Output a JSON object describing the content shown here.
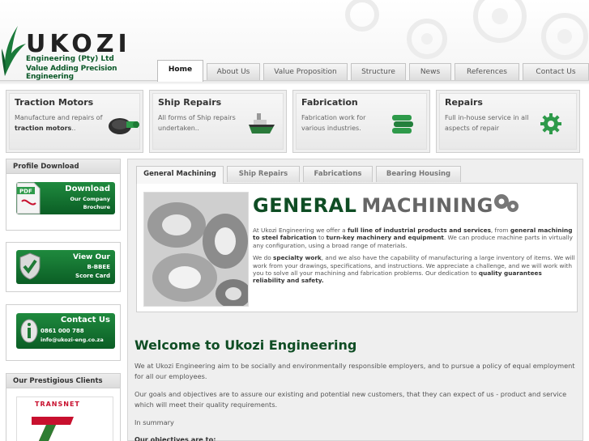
{
  "brand": {
    "name": "UKOZI",
    "sub1": "Engineering (Pty) Ltd",
    "sub2": "Value Adding Precision Engineering"
  },
  "nav": {
    "tabs": [
      {
        "label": "Home",
        "active": true
      },
      {
        "label": "About Us"
      },
      {
        "label": "Value Proposition"
      },
      {
        "label": "Structure"
      },
      {
        "label": "News"
      },
      {
        "label": "References"
      },
      {
        "label": "Contact Us"
      }
    ]
  },
  "features": [
    {
      "title": "Traction Motors",
      "text_a": "Manufacture and repairs of",
      "text_b": "traction motors",
      "text_c": "..",
      "icon": "traction-motor-icon"
    },
    {
      "title": "Ship Repairs",
      "text_a": "All forms of Ship repairs undertaken..",
      "icon": "ship-icon"
    },
    {
      "title": "Fabrication",
      "text_a": "Fabrication work for various industries.",
      "icon": "fabrication-icon"
    },
    {
      "title": "Repairs",
      "text_a": "Full in-house service in all aspects of repair",
      "icon": "gear-icon"
    }
  ],
  "sidebar": {
    "profile_title": "Profile Download",
    "download": {
      "line1": "Download",
      "line2": "Our Company",
      "line3": "Brochure",
      "pdf": "PDF"
    },
    "bbbee": {
      "line1": "View Our",
      "line2": "B-BBEE",
      "line3": "Score Card"
    },
    "contact": {
      "line1": "Contact Us",
      "line2": "0861 000 788",
      "line3": "info@ukozi-eng.co.za"
    },
    "clients_title": "Our Prestigious Clients",
    "client_logo_text": "TRANSNET"
  },
  "content_tabs": [
    {
      "label": "General Machining",
      "active": true
    },
    {
      "label": "Ship Repairs"
    },
    {
      "label": "Fabrications"
    },
    {
      "label": "Bearing Housing"
    }
  ],
  "general_machining": {
    "title_a": "GENERAL",
    "title_b": "MACHINING",
    "p1_a": "At Ukozi Engineering we offer a",
    "p1_b": "full line of industrial products and services",
    "p1_c": ", from",
    "p1_d": "general machining to steel fabrication",
    "p1_e": "to",
    "p1_f": "turn-key machinery and equipment",
    "p1_g": ". We can produce machine parts in virtually any configuration, using a broad range of materials.",
    "p2_a": "We do",
    "p2_b": "specialty work",
    "p2_c": ", and we also have the capability of manufacturing a large inventory of items. We will work from your drawings, specifications, and instructions. We appreciate a challenge, and we will work with you to solve all your machining and fabrication problems. Our dedication to",
    "p2_d": "quality guarantees reliability and safety."
  },
  "welcome": {
    "heading": "Welcome to Ukozi Engineering",
    "p1": "We at Ukozi Engineering aim to be socially and environmentally responsible employers, and to pursue a policy of equal employment for all our employees.",
    "p2": "Our goals and objectives are to assure our existing and potential new customers, that they can expect of us - product and service which will meet their quality requirements.",
    "p3": "In summary",
    "p4": "Our objectives are to:"
  },
  "colors": {
    "brand_green": "#0f4d24",
    "badge_green": "#1f8a3e",
    "transnet_red": "#c8102e"
  }
}
